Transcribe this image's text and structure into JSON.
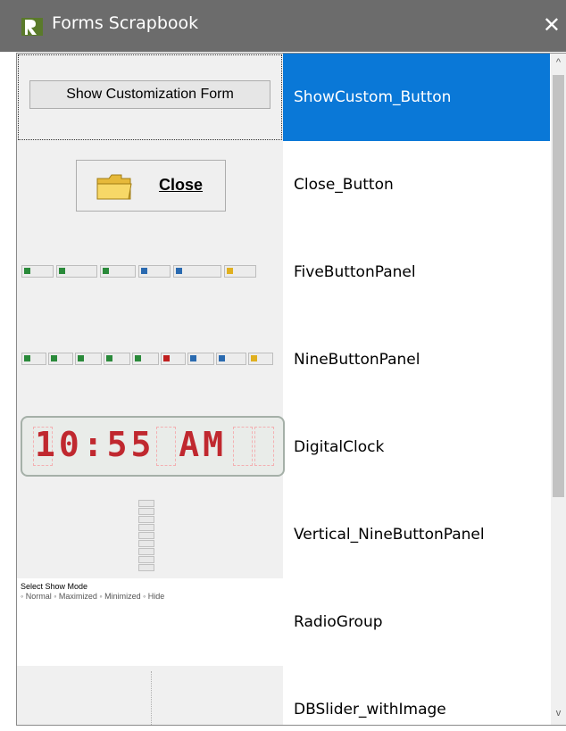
{
  "window": {
    "title": "Forms Scrapbook",
    "close_glyph": "✕"
  },
  "list": {
    "items": [
      {
        "name": "ShowCustom_Button",
        "preview_text": "Show Customization Form",
        "selected": true
      },
      {
        "name": "Close_Button",
        "preview_text": "Close"
      },
      {
        "name": "FiveButtonPanel"
      },
      {
        "name": "NineButtonPanel"
      },
      {
        "name": "DigitalClock",
        "preview_text": "10:55 AM"
      },
      {
        "name": "Vertical_NineButtonPanel"
      },
      {
        "name": "RadioGroup",
        "preview_title": "Select Show Mode",
        "preview_options": "◦ Normal    ◦ Maximized   ◦ Minimized   ◦ Hide"
      },
      {
        "name": "DBSlider_withImage"
      }
    ]
  },
  "scrollbar": {
    "up_glyph": "^",
    "down_glyph": "v"
  },
  "colors": {
    "selection": "#0a78d7",
    "titlebar": "#6c6c6c",
    "clock_digit": "#c0282f"
  }
}
